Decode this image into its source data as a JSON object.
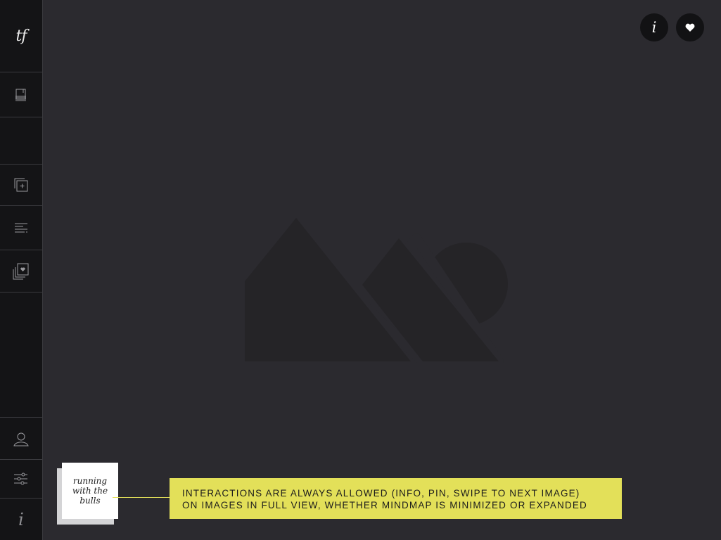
{
  "sidebar": {
    "logo": "tf",
    "items": [
      {
        "name": "library-icon"
      },
      {
        "name": "blank"
      },
      {
        "name": "add-collection-icon"
      },
      {
        "name": "list-icon"
      },
      {
        "name": "favorites-icon"
      }
    ],
    "bottom": [
      {
        "name": "profile-icon"
      },
      {
        "name": "settings-sliders-icon"
      },
      {
        "name": "info-icon",
        "label": "i"
      }
    ]
  },
  "toolbar": {
    "info_label": "i",
    "pin_icon": "heart-icon"
  },
  "viewer": {
    "placeholder_icon": "image-placeholder-icon"
  },
  "mindmap": {
    "card_label": "running with the bulls"
  },
  "annotation": {
    "line1": "INTERACTIONS ARE ALWAYS ALLOWED (INFO, PIN, SWIPE TO NEXT IMAGE)",
    "line2": "ON IMAGES IN FULL VIEW, WHETHER MINDMAP IS MINIMIZED OR EXPANDED"
  },
  "colors": {
    "background": "#2b2a2f",
    "sidebar": "#141416",
    "accent_yellow": "#e3e059",
    "placeholder_shape": "#252427"
  }
}
